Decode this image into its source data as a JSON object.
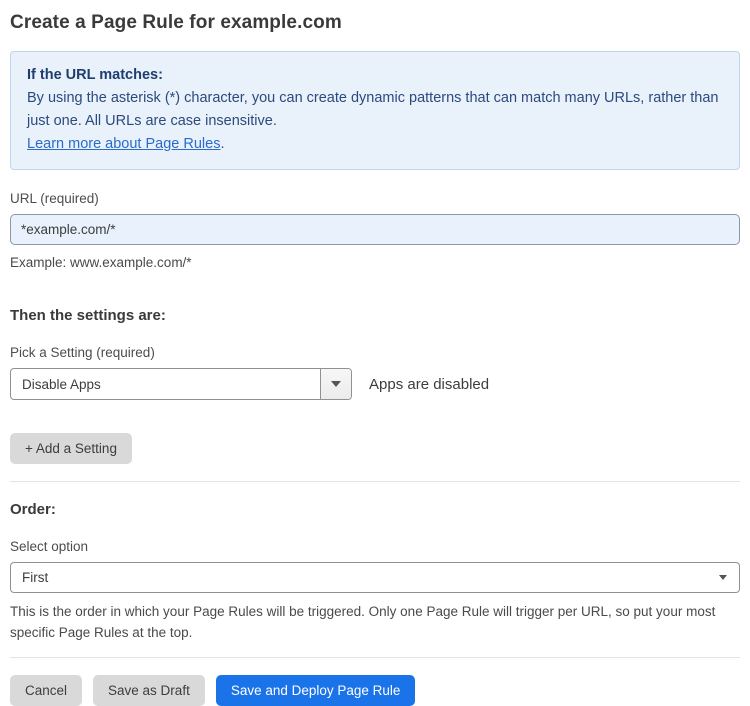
{
  "page_title": "Create a Page Rule for example.com",
  "info_box": {
    "heading": "If the URL matches:",
    "body": "By using the asterisk (*) character, you can create dynamic patterns that can match many URLs, rather than just one. All URLs are case insensitive.",
    "link_label": "Learn more about Page Rules",
    "link_suffix": "."
  },
  "url_field": {
    "label": "URL (required)",
    "value": "*example.com/*",
    "helper": "Example: www.example.com/*"
  },
  "settings_section": {
    "heading": "Then the settings are:",
    "picker_label": "Pick a Setting (required)",
    "selected_setting": "Disable Apps",
    "setting_status": "Apps are disabled",
    "add_setting_label": "+ Add a Setting"
  },
  "order_section": {
    "heading": "Order:",
    "select_label": "Select option",
    "selected_option": "First",
    "helper": "This is the order in which your Page Rules will be triggered. Only one Page Rule will trigger per URL, so put your most specific Page Rules at the top."
  },
  "footer": {
    "cancel_label": "Cancel",
    "save_draft_label": "Save as Draft",
    "save_deploy_label": "Save and Deploy Page Rule"
  },
  "colors": {
    "accent_blue": "#1a73e8",
    "info_background": "#e9f1fb",
    "info_border": "#bcd7f1",
    "info_text": "#2b4a7d",
    "link_blue": "#2a6bcc",
    "input_highlight_background": "#e9f1fc",
    "gray_button_background": "#d9d9d9"
  },
  "icons": {
    "dropdown_caret": "caret-down"
  }
}
